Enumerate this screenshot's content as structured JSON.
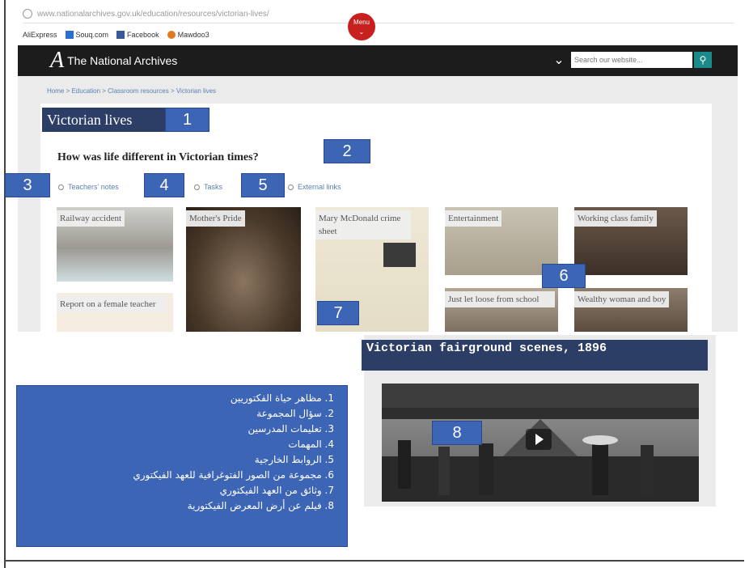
{
  "browser": {
    "url": "www.nationalarchives.gov.uk/education/resources/victorian-lives/",
    "bookmarks": [
      {
        "label": "AliExpress"
      },
      {
        "label": "Souq.com"
      },
      {
        "label": "Facebook"
      },
      {
        "label": "Mawdoo3"
      }
    ]
  },
  "header": {
    "logo_letter": "A",
    "site_name": "The National Archives",
    "menu_label": "Menu",
    "search_placeholder": "Search our website...",
    "brand_color": "#1c1c1c",
    "accent_color": "#c8201f",
    "search_button_color": "#1b8a8a"
  },
  "breadcrumb": "Home > Education > Classroom resources > Victorian lives",
  "page": {
    "title": "Victorian lives",
    "question": "How was life different in Victorian times?",
    "links": [
      "Teachers' notes",
      "Tasks",
      "External links"
    ]
  },
  "gallery": [
    {
      "label": "Railway accident"
    },
    {
      "label": "Mother's Pride"
    },
    {
      "label": "Mary McDonald crime sheet"
    },
    {
      "label": "Entertainment"
    },
    {
      "label": "Working class family"
    },
    {
      "label": "Report on a female teacher"
    },
    {
      "label": "Just let loose from school"
    },
    {
      "label": "Wealthy woman and boy"
    }
  ],
  "video": {
    "title": "Victorian fairground scenes, 1896"
  },
  "annotation_numbers": [
    "1",
    "2",
    "3",
    "4",
    "5",
    "6",
    "7",
    "8"
  ],
  "annotation_color": "#3d65b5",
  "legend": [
    "1. مظاهر حياة الفكتوريين",
    "2. سؤال المجموعة",
    "3. تعليمات المدرسين",
    "4. المهمات",
    "5. الروابط الخارجية",
    "6. مجموعة من الصور الفتوغرافية للعهد الفيكتوري",
    "7. وثائق من العهد الفيكتوري",
    "8. فيلم عن أرض المعرض الفيكتورية"
  ]
}
